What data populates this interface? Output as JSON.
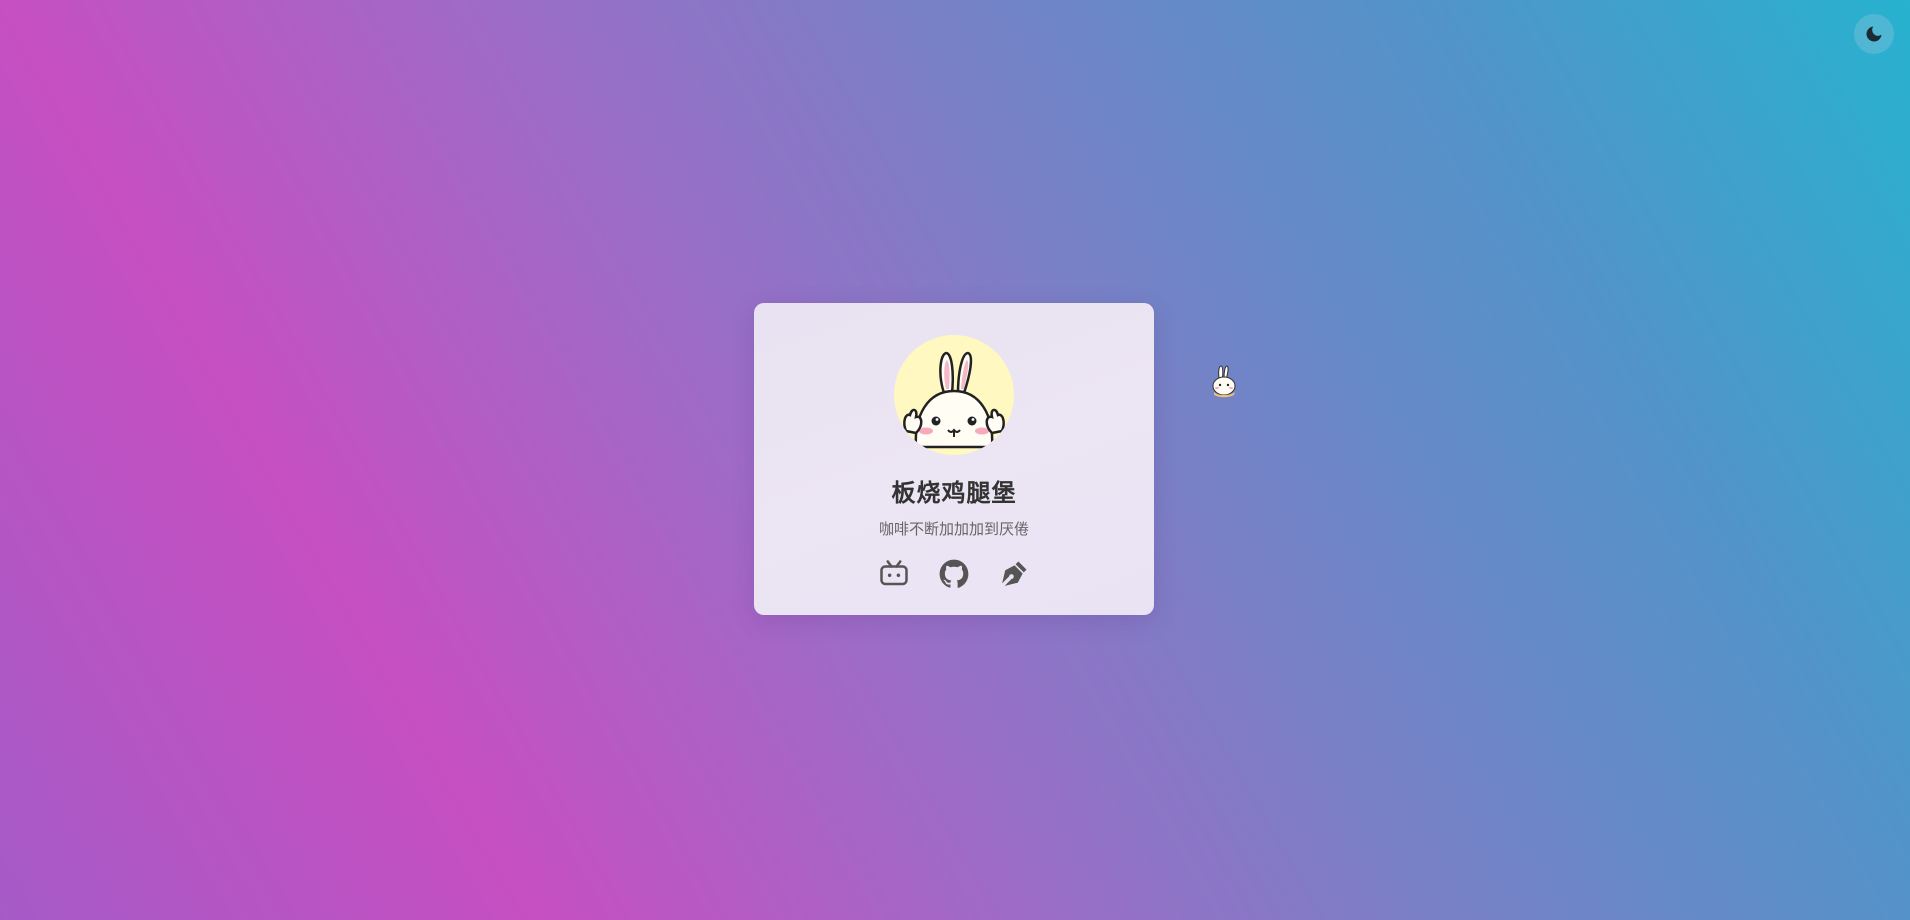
{
  "theme_toggle": {
    "icon": "moon-icon"
  },
  "profile": {
    "name": "板烧鸡腿堡",
    "bio": "咖啡不断加加加到厌倦",
    "avatar": "bunny-avatar"
  },
  "social_links": [
    {
      "icon": "bilibili-icon"
    },
    {
      "icon": "github-icon"
    },
    {
      "icon": "blog-pen-icon"
    }
  ],
  "colors": {
    "card_bg": "#ece5f3",
    "name_text": "#333333",
    "bio_text": "#666666",
    "icon_color": "#555555",
    "avatar_bg": "#fff8c0"
  }
}
